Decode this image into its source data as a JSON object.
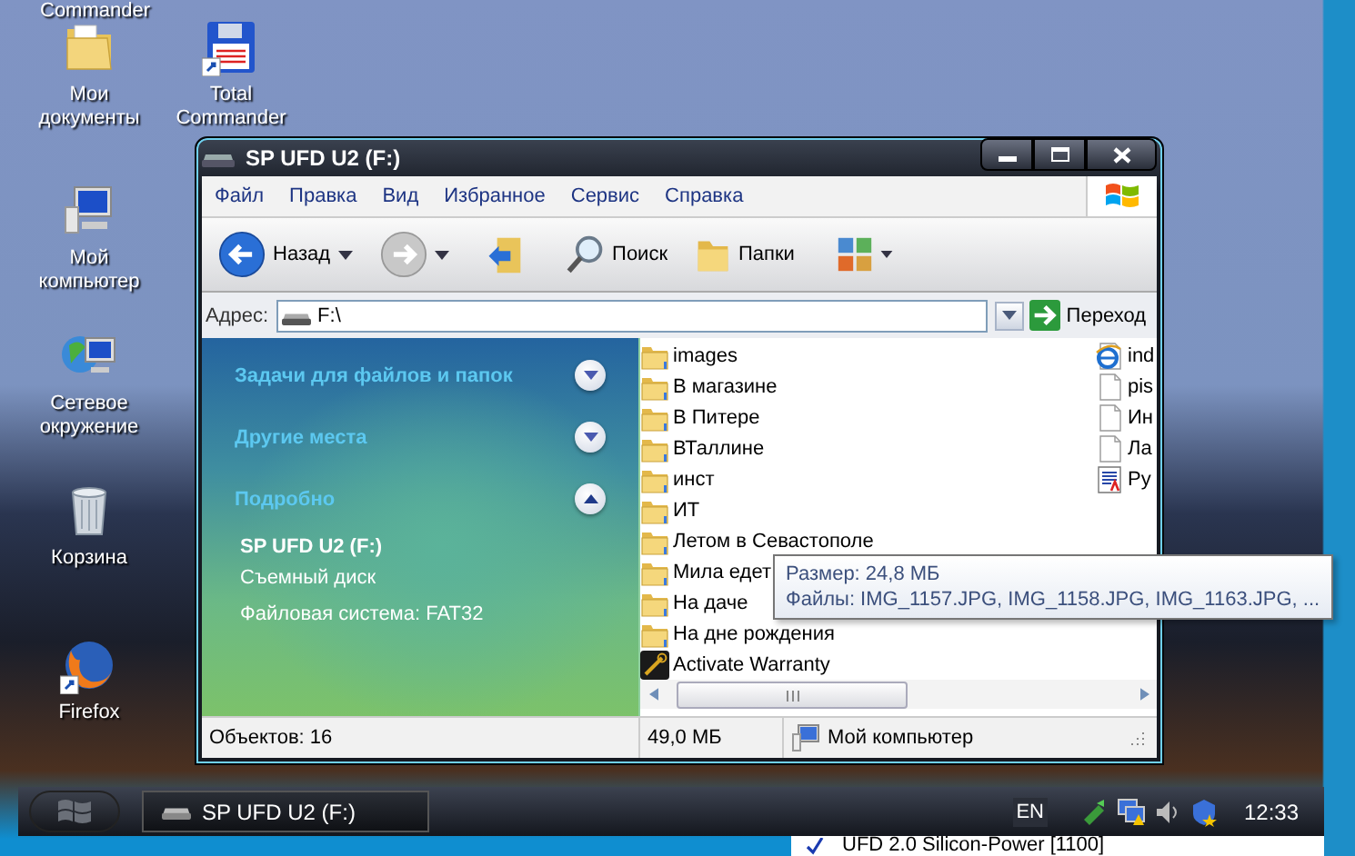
{
  "desktop_partial_label": "Commander",
  "desktop_icons": [
    {
      "label": "Мои документы",
      "kind": "folder",
      "shortcut": false
    },
    {
      "label": "Total Commander",
      "kind": "floppy",
      "shortcut": true
    },
    {
      "label": "Мой компьютер",
      "kind": "computer",
      "shortcut": false
    },
    {
      "label": "Сетевое окружение",
      "kind": "network",
      "shortcut": false
    },
    {
      "label": "Корзина",
      "kind": "trash",
      "shortcut": false
    },
    {
      "label": "Firefox",
      "kind": "firefox",
      "shortcut": true
    }
  ],
  "window": {
    "title": "SP UFD U2 (F:)",
    "menu": [
      "Файл",
      "Правка",
      "Вид",
      "Избранное",
      "Сервис",
      "Справка"
    ],
    "toolbar": [
      {
        "kind": "back",
        "label": "Назад",
        "disabled": false
      },
      {
        "kind": "forward",
        "disabled": true
      },
      {
        "kind": "up"
      },
      {
        "kind": "search",
        "label": "Поиск"
      },
      {
        "kind": "folders",
        "label": "Папки"
      },
      {
        "kind": "views"
      }
    ],
    "address": {
      "label": "Адрес:",
      "value": "F:\\",
      "go": "Переход"
    },
    "sidebar": {
      "sections": [
        {
          "title": "Задачи для файлов и папок",
          "expanded": false
        },
        {
          "title": "Другие места",
          "expanded": false
        },
        {
          "title": "Подробно",
          "expanded": true,
          "details": {
            "name": "SP UFD U2 (F:)",
            "type": "Съемный диск",
            "filesystem": "Файловая система: FAT32"
          }
        }
      ]
    },
    "files": {
      "column_1": [
        {
          "name": "images",
          "kind": "folder"
        },
        {
          "name": "В магазине",
          "kind": "folder"
        },
        {
          "name": "В Питере",
          "kind": "folder"
        },
        {
          "name": "ВТаллине",
          "kind": "folder"
        },
        {
          "name": "инст",
          "kind": "folder"
        },
        {
          "name": "ИТ",
          "kind": "folder"
        },
        {
          "name": "Летом в Севастополе",
          "kind": "folder"
        },
        {
          "name": "Мила едет",
          "kind": "folder"
        },
        {
          "name": "На даче",
          "kind": "folder"
        },
        {
          "name": "На дне рождения",
          "kind": "folder"
        },
        {
          "name": "Activate Warranty",
          "kind": "app"
        }
      ],
      "column_2": [
        {
          "name": "ind",
          "kind": "html"
        },
        {
          "name": "pis",
          "kind": "file"
        },
        {
          "name": "Ин",
          "kind": "file"
        },
        {
          "name": "Ла",
          "kind": "file"
        },
        {
          "name": "Ру",
          "kind": "doc"
        }
      ]
    },
    "tooltip": [
      "Размер: 24,8 МБ",
      "Файлы: IMG_1157.JPG, IMG_1158.JPG, IMG_1163.JPG, ..."
    ],
    "status_bar": {
      "objects": "Объектов: 16",
      "size": "49,0 МБ",
      "location": "Мой компьютер"
    }
  },
  "taskbar": {
    "task": "SP UFD U2 (F:)",
    "language": "EN",
    "clock": "12:33"
  },
  "popup_menu": [
    {
      "label": "UFD 2.0 Silicon-Power [1100]",
      "checked": true
    }
  ]
}
